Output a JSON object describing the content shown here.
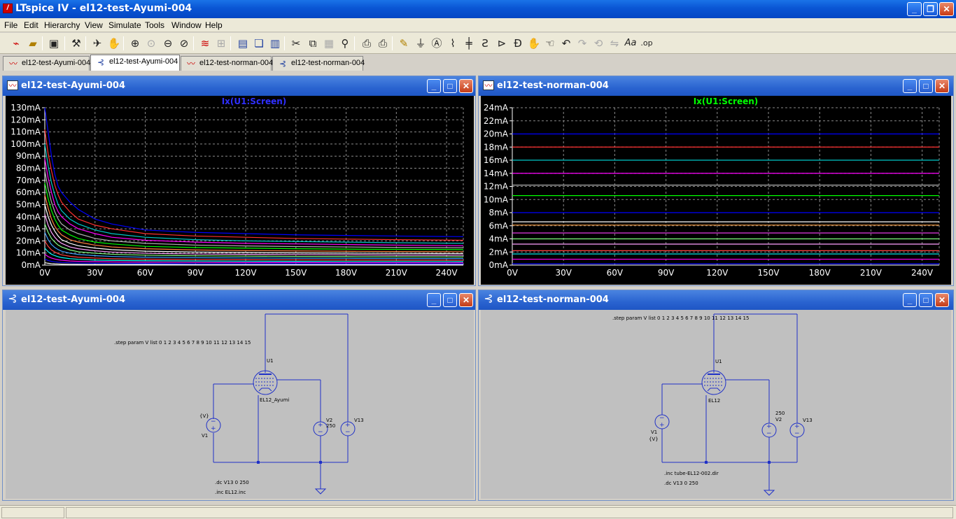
{
  "app": {
    "title": "LTspice IV - el12-test-Ayumi-004",
    "icon": "ltspice-logo-icon",
    "window_buttons": [
      "minimize",
      "restore",
      "close"
    ]
  },
  "menu": [
    "File",
    "Edit",
    "Hierarchy",
    "View",
    "Simulate",
    "Tools",
    "Window",
    "Help"
  ],
  "toolbar_icons": [
    "new-schematic",
    "open",
    "save",
    "control-panel",
    "run",
    "halt",
    "zoom-in",
    "pan",
    "zoom-out",
    "zoom-fit",
    "autorange",
    "grid",
    "tile-horizontal",
    "cascade",
    "tile-vertical",
    "cut",
    "copy",
    "paste",
    "find",
    "print-preview",
    "print",
    "draw-wire",
    "ground",
    "label-net",
    "resistor",
    "capacitor",
    "inductor",
    "diode",
    "component",
    "move",
    "drag",
    "undo",
    "redo",
    "rotate",
    "mirror",
    "text",
    "spice-directive"
  ],
  "tabs": [
    {
      "label": "el12-test-Ayumi-004",
      "kind": "waveform",
      "active": false
    },
    {
      "label": "el12-test-Ayumi-004",
      "kind": "schematic",
      "active": true
    },
    {
      "label": "el12-test-norman-004",
      "kind": "waveform",
      "active": false
    },
    {
      "label": "el12-test-norman-004",
      "kind": "schematic",
      "active": false
    }
  ],
  "windows": {
    "plot_ayumi": {
      "title": "el12-test-Ayumi-004"
    },
    "plot_norman": {
      "title": "el12-test-norman-004"
    },
    "schem_ayumi": {
      "title": "el12-test-Ayumi-004",
      "step_directive": ".step param V list 0 1 2 3 4 5 6 7 8 9 10 11 12 13 14 15",
      "u1": "U1",
      "tube_model": "EL12_Ayumi",
      "v1_value": "{V}",
      "v1_name": "V1",
      "v2_name": "V2",
      "v2_value": "250",
      "v13_name": "V13",
      "dc_directive": ".dc V13 0 250",
      "inc_directive": ".inc EL12.inc"
    },
    "schem_norman": {
      "title": "el12-test-norman-004",
      "step_directive": ".step param V list 0 1 2 3 4 5 6 7 8 9 10 11 12 13 14 15",
      "u1": "U1",
      "tube_model": "EL12",
      "v1_name": "V1",
      "v1_value": "{V}",
      "v2_value": "250",
      "v2_name": "V2",
      "v13_name": "V13",
      "inc_directive": ".inc tube-EL12-002.dir",
      "dc_directive": ".dc V13 0 250"
    }
  },
  "colors": {
    "xp_blue": "#0a55d4",
    "plot_bg": "#000000",
    "schematic_bg": "#c0c0c0",
    "wire": "#1f30c8"
  },
  "chart_data": [
    {
      "type": "line",
      "title": "Ix(U1:Screen)",
      "title_color": "#2f2fff",
      "x_ticks": [
        "0V",
        "30V",
        "60V",
        "90V",
        "120V",
        "150V",
        "180V",
        "210V",
        "240V"
      ],
      "y_ticks": [
        "0mA",
        "10mA",
        "20mA",
        "30mA",
        "40mA",
        "50mA",
        "60mA",
        "70mA",
        "80mA",
        "90mA",
        "100mA",
        "110mA",
        "120mA",
        "130mA"
      ],
      "xlim": [
        0,
        250
      ],
      "ylim": [
        0,
        130
      ],
      "grid": true,
      "x": [
        0,
        2,
        4,
        6,
        8,
        10,
        15,
        20,
        30,
        40,
        60,
        90,
        120,
        150,
        180,
        210,
        250
      ],
      "series": [
        {
          "color": "#0000ff",
          "values": [
            130,
            110,
            90,
            75,
            65,
            60,
            52,
            46,
            38,
            34,
            29,
            27,
            26,
            25,
            24.5,
            24,
            23.5
          ]
        },
        {
          "color": "#ff3030",
          "values": [
            112,
            92,
            78,
            66,
            58,
            52,
            44,
            38,
            33,
            30,
            26,
            24,
            23,
            22,
            21.5,
            21,
            20.5
          ]
        },
        {
          "color": "#00c8c8",
          "values": [
            100,
            82,
            68,
            58,
            50,
            45,
            38,
            34,
            29,
            26,
            23,
            21,
            20,
            19.5,
            19,
            18.5,
            18
          ]
        },
        {
          "color": "#ff00ff",
          "values": [
            88,
            72,
            60,
            50,
            44,
            40,
            34,
            30,
            26,
            23,
            20.5,
            19,
            18,
            17.5,
            17,
            16.5,
            16
          ]
        },
        {
          "color": "#b0b0b0",
          "values": [
            78,
            63,
            52,
            44,
            38,
            34,
            29,
            26,
            22,
            20,
            18,
            16.5,
            15.8,
            15.3,
            15,
            14.6,
            14.3
          ]
        },
        {
          "color": "#00ff00",
          "values": [
            68,
            55,
            45,
            38,
            33,
            29,
            25,
            22,
            19,
            17.5,
            15.5,
            14.5,
            14,
            13.5,
            13.2,
            13,
            12.8
          ]
        },
        {
          "color": "#ff8040",
          "values": [
            58,
            47,
            38,
            32,
            28,
            25,
            21,
            19,
            16.5,
            15,
            13.5,
            12.5,
            12,
            11.7,
            11.4,
            11.2,
            11
          ]
        },
        {
          "color": "#ffffff",
          "values": [
            50,
            40,
            33,
            28,
            24,
            21,
            18,
            16,
            14,
            12.8,
            11.5,
            10.8,
            10.4,
            10.1,
            9.9,
            9.7,
            9.5
          ]
        },
        {
          "color": "#ffa0ff",
          "values": [
            42,
            33,
            27,
            23,
            20,
            18,
            15,
            13.5,
            11.8,
            10.8,
            9.8,
            9.2,
            8.9,
            8.7,
            8.5,
            8.3,
            8.2
          ]
        },
        {
          "color": "#80ff80",
          "values": [
            34,
            27,
            22,
            19,
            16.5,
            15,
            12.5,
            11,
            9.8,
            9,
            8.2,
            7.7,
            7.4,
            7.2,
            7,
            6.9,
            6.8
          ]
        },
        {
          "color": "#40a0ff",
          "values": [
            27,
            21,
            17,
            14.5,
            12.8,
            11.5,
            9.8,
            8.8,
            7.8,
            7.2,
            6.5,
            6.1,
            5.9,
            5.7,
            5.6,
            5.5,
            5.4
          ]
        },
        {
          "color": "#ff4040",
          "values": [
            20,
            15.5,
            12.5,
            10.8,
            9.5,
            8.5,
            7.3,
            6.5,
            5.8,
            5.3,
            4.9,
            4.6,
            4.4,
            4.3,
            4.2,
            4.1,
            4
          ]
        },
        {
          "color": "#00ffff",
          "values": [
            14,
            11,
            9,
            7.8,
            6.9,
            6.2,
            5.3,
            4.8,
            4.2,
            3.9,
            3.6,
            3.4,
            3.2,
            3.1,
            3,
            3,
            2.9
          ]
        },
        {
          "color": "#ff00ff",
          "values": [
            9,
            7,
            5.8,
            5,
            4.4,
            4,
            3.4,
            3.1,
            2.8,
            2.6,
            2.4,
            2.2,
            2.1,
            2.1,
            2,
            2,
            1.9
          ]
        },
        {
          "color": "#0000ff",
          "values": [
            5,
            3.8,
            3.1,
            2.7,
            2.4,
            2.2,
            1.9,
            1.7,
            1.5,
            1.4,
            1.3,
            1.2,
            1.2,
            1.1,
            1.1,
            1.1,
            1
          ]
        },
        {
          "color": "#ffffff",
          "values": [
            2,
            1.5,
            1.2,
            1,
            0.9,
            0.8,
            0.7,
            0.6,
            0.5,
            0.5,
            0.5,
            0.4,
            0.4,
            0.4,
            0.4,
            0.4,
            0.4
          ]
        }
      ]
    },
    {
      "type": "line",
      "title": "Ix(U1:Screen)",
      "title_color": "#00ff00",
      "x_ticks": [
        "0V",
        "30V",
        "60V",
        "90V",
        "120V",
        "150V",
        "180V",
        "210V",
        "240V"
      ],
      "y_ticks": [
        "0mA",
        "2mA",
        "4mA",
        "6mA",
        "8mA",
        "10mA",
        "12mA",
        "14mA",
        "16mA",
        "18mA",
        "20mA",
        "22mA",
        "24mA"
      ],
      "xlim": [
        0,
        250
      ],
      "ylim": [
        0,
        24
      ],
      "grid": true,
      "x": [
        0,
        250
      ],
      "series": [
        {
          "color": "#0000ff",
          "values": [
            20,
            20
          ]
        },
        {
          "color": "#ff3030",
          "values": [
            18,
            18
          ]
        },
        {
          "color": "#00c8c8",
          "values": [
            16,
            16
          ]
        },
        {
          "color": "#ff00ff",
          "values": [
            14,
            14
          ]
        },
        {
          "color": "#b0b0b0",
          "values": [
            12.2,
            12.2
          ]
        },
        {
          "color": "#00ff00",
          "values": [
            10.6,
            10.6
          ]
        },
        {
          "color": "#0000ff",
          "values": [
            8,
            8
          ]
        },
        {
          "color": "#ffffff",
          "values": [
            6.6,
            6.6
          ]
        },
        {
          "color": "#ffa040",
          "values": [
            6.1,
            6.1
          ]
        },
        {
          "color": "#ff40ff",
          "values": [
            4.9,
            4.9
          ]
        },
        {
          "color": "#80ff80",
          "values": [
            4,
            4
          ]
        },
        {
          "color": "#ffa0ff",
          "values": [
            3.2,
            3.2
          ]
        },
        {
          "color": "#ff4040",
          "values": [
            2.2,
            2.2
          ]
        },
        {
          "color": "#00ffff",
          "values": [
            1.7,
            1.7
          ]
        },
        {
          "color": "#ff00ff",
          "values": [
            0.9,
            0.9
          ]
        },
        {
          "color": "#0000ff",
          "values": [
            0.2,
            0.2
          ]
        }
      ]
    }
  ]
}
